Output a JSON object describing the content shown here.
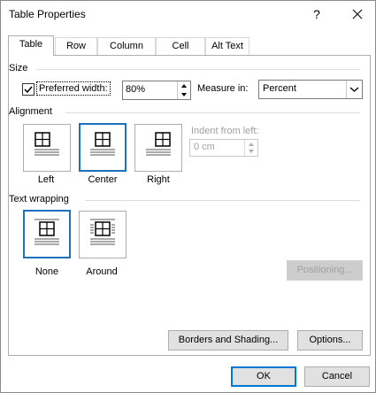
{
  "window": {
    "title": "Table Properties",
    "help": "?"
  },
  "tabs": [
    {
      "label": "Table",
      "active": true
    },
    {
      "label": "Row",
      "active": false
    },
    {
      "label": "Column",
      "active": false
    },
    {
      "label": "Cell",
      "active": false
    },
    {
      "label": "Alt Text",
      "active": false
    }
  ],
  "size": {
    "heading": "Size",
    "preferred_width_label": "Preferred width:",
    "preferred_width_checked": true,
    "preferred_width_value": "80%",
    "measure_in_label": "Measure in:",
    "measure_in_value": "Percent"
  },
  "alignment": {
    "heading": "Alignment",
    "options": [
      "Left",
      "Center",
      "Right"
    ],
    "selected": "Center",
    "indent_label": "Indent from left:",
    "indent_value": "0 cm"
  },
  "text_wrapping": {
    "heading": "Text wrapping",
    "options": [
      "None",
      "Around"
    ],
    "selected": "None",
    "positioning_label": "Positioning..."
  },
  "buttons": {
    "borders": "Borders and Shading...",
    "options": "Options...",
    "ok": "OK",
    "cancel": "Cancel"
  },
  "colors": {
    "accent": "#1f6fbf",
    "primary_border": "#0078d7"
  }
}
